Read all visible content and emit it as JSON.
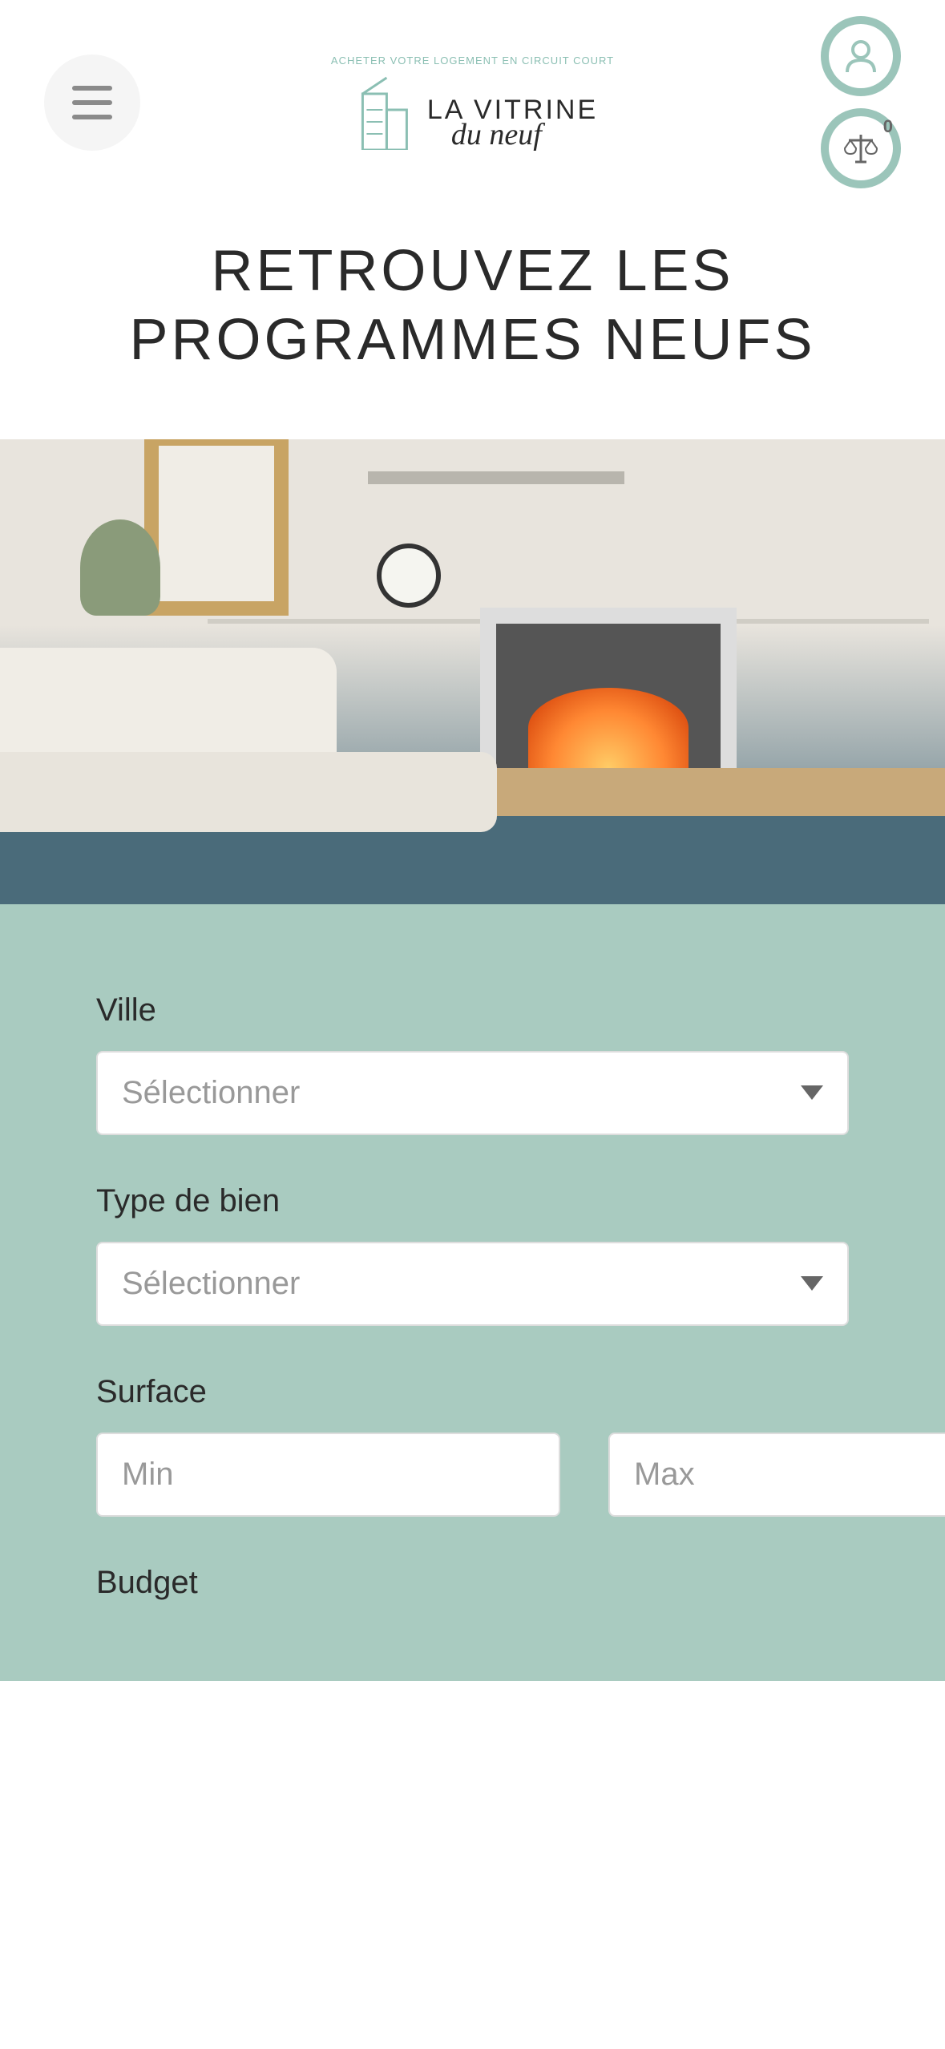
{
  "header": {
    "logo_tagline": "ACHETER VOTRE LOGEMENT EN CIRCUIT COURT",
    "logo_text_top": "LA VITRINE",
    "logo_text_bottom": "du neuf",
    "compare_badge": "0"
  },
  "page_title": "RETROUVEZ LES PROGRAMMES NEUFS",
  "search": {
    "ville": {
      "label": "Ville",
      "placeholder": "Sélectionner"
    },
    "type_bien": {
      "label": "Type de bien",
      "placeholder": "Sélectionner"
    },
    "surface": {
      "label": "Surface",
      "min_placeholder": "Min",
      "max_placeholder": "Max"
    },
    "budget": {
      "label": "Budget"
    }
  }
}
